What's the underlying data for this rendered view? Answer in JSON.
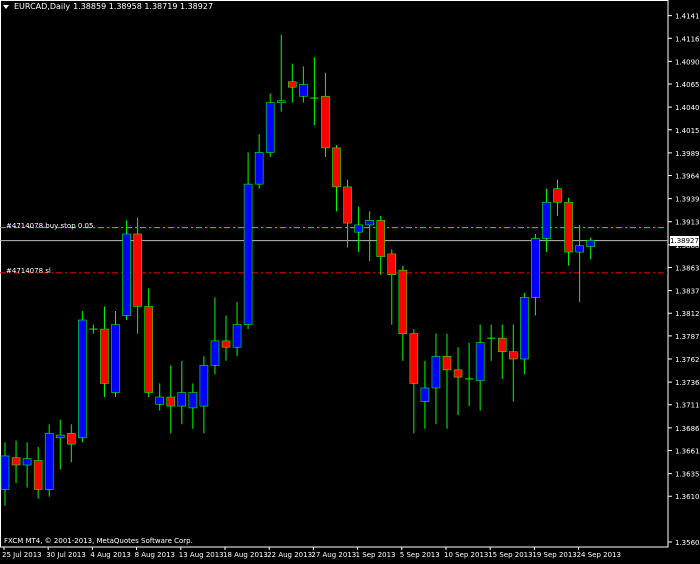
{
  "header": {
    "symbol_label": "EURCAD,Daily",
    "ohlc": "1.38859 1.38958 1.38719 1.38927"
  },
  "footer": {
    "copyright": "FXCM MT4, © 2001-2013, MetaQuotes Software Corp."
  },
  "levels": {
    "buy_stop": {
      "label": "#4714078 buy stop 0.05",
      "price": 1.3907,
      "color": "#00ff00"
    },
    "stop_loss": {
      "label": "#4714078 sl",
      "price": 1.3857,
      "color": "#ff0000"
    },
    "current": {
      "label": "1.38927",
      "price": 1.38927
    }
  },
  "colors": {
    "background": "#000000",
    "bull": "#0000ff",
    "bear": "#ff0000",
    "wick": "#00ff00",
    "axis": "#ffffff"
  },
  "chart_data": {
    "type": "candlestick",
    "ylim": [
      1.356,
      1.4145
    ],
    "y_ticks": [
      "1.41410",
      "1.41160",
      "1.40905",
      "1.40655",
      "1.40400",
      "1.40150",
      "1.39895",
      "1.39645",
      "1.39390",
      "1.39135",
      "1.38880",
      "1.38630",
      "1.38375",
      "1.38125",
      "1.37875",
      "1.37620",
      "1.37365",
      "1.37115",
      "1.36860",
      "1.36610",
      "1.36355",
      "1.36105",
      "1.35600"
    ],
    "x_ticks": [
      "25 Jul 2013",
      "30 Jul 2013",
      "4 Aug 2013",
      "8 Aug 2013",
      "13 Aug 2013",
      "18 Aug 2013",
      "22 Aug 2013",
      "27 Aug 2013",
      "1 Sep 2013",
      "5 Sep 2013",
      "10 Sep 2013",
      "15 Sep 2013",
      "19 Sep 2013",
      "24 Sep 2013"
    ],
    "candles": [
      {
        "o": 1.3618,
        "h": 1.367,
        "l": 1.36,
        "c": 1.3655
      },
      {
        "o": 1.3653,
        "h": 1.3672,
        "l": 1.3625,
        "c": 1.3645
      },
      {
        "o": 1.3645,
        "h": 1.367,
        "l": 1.362,
        "c": 1.3652
      },
      {
        "o": 1.365,
        "h": 1.3665,
        "l": 1.3608,
        "c": 1.3618
      },
      {
        "o": 1.3618,
        "h": 1.369,
        "l": 1.361,
        "c": 1.368
      },
      {
        "o": 1.3675,
        "h": 1.3695,
        "l": 1.364,
        "c": 1.3678
      },
      {
        "o": 1.368,
        "h": 1.369,
        "l": 1.3648,
        "c": 1.3668
      },
      {
        "o": 1.3675,
        "h": 1.3815,
        "l": 1.367,
        "c": 1.3805
      },
      {
        "o": 1.3795,
        "h": 1.38,
        "l": 1.379,
        "c": 1.3795
      },
      {
        "o": 1.3795,
        "h": 1.382,
        "l": 1.372,
        "c": 1.3735
      },
      {
        "o": 1.3725,
        "h": 1.3815,
        "l": 1.372,
        "c": 1.38
      },
      {
        "o": 1.381,
        "h": 1.3915,
        "l": 1.3805,
        "c": 1.39
      },
      {
        "o": 1.39,
        "h": 1.3918,
        "l": 1.379,
        "c": 1.382
      },
      {
        "o": 1.382,
        "h": 1.384,
        "l": 1.372,
        "c": 1.3725
      },
      {
        "o": 1.3712,
        "h": 1.3735,
        "l": 1.3705,
        "c": 1.372
      },
      {
        "o": 1.372,
        "h": 1.3755,
        "l": 1.368,
        "c": 1.371
      },
      {
        "o": 1.371,
        "h": 1.376,
        "l": 1.369,
        "c": 1.3725
      },
      {
        "o": 1.3708,
        "h": 1.3735,
        "l": 1.3685,
        "c": 1.3725
      },
      {
        "o": 1.371,
        "h": 1.3765,
        "l": 1.368,
        "c": 1.3755
      },
      {
        "o": 1.3755,
        "h": 1.383,
        "l": 1.3745,
        "c": 1.3782
      },
      {
        "o": 1.3782,
        "h": 1.381,
        "l": 1.376,
        "c": 1.3775
      },
      {
        "o": 1.3775,
        "h": 1.3825,
        "l": 1.3765,
        "c": 1.38
      },
      {
        "o": 1.38,
        "h": 1.399,
        "l": 1.3795,
        "c": 1.3955
      },
      {
        "o": 1.3955,
        "h": 1.401,
        "l": 1.395,
        "c": 1.399
      },
      {
        "o": 1.399,
        "h": 1.4055,
        "l": 1.3985,
        "c": 1.4045
      },
      {
        "o": 1.4045,
        "h": 1.412,
        "l": 1.4035,
        "c": 1.4047
      },
      {
        "o": 1.4068,
        "h": 1.4088,
        "l": 1.4045,
        "c": 1.4062
      },
      {
        "o": 1.4052,
        "h": 1.4085,
        "l": 1.4045,
        "c": 1.4065
      },
      {
        "o": 1.405,
        "h": 1.4095,
        "l": 1.402,
        "c": 1.405
      },
      {
        "o": 1.4052,
        "h": 1.4078,
        "l": 1.3985,
        "c": 1.3995
      },
      {
        "o": 1.3995,
        "h": 1.3998,
        "l": 1.3925,
        "c": 1.3952
      },
      {
        "o": 1.3952,
        "h": 1.396,
        "l": 1.3885,
        "c": 1.3912
      },
      {
        "o": 1.3902,
        "h": 1.393,
        "l": 1.388,
        "c": 1.391
      },
      {
        "o": 1.391,
        "h": 1.3925,
        "l": 1.387,
        "c": 1.3915
      },
      {
        "o": 1.3915,
        "h": 1.392,
        "l": 1.3855,
        "c": 1.3875
      },
      {
        "o": 1.3878,
        "h": 1.3883,
        "l": 1.38,
        "c": 1.3855
      },
      {
        "o": 1.386,
        "h": 1.3865,
        "l": 1.376,
        "c": 1.379
      },
      {
        "o": 1.379,
        "h": 1.3795,
        "l": 1.368,
        "c": 1.3735
      },
      {
        "o": 1.3715,
        "h": 1.376,
        "l": 1.3685,
        "c": 1.373
      },
      {
        "o": 1.373,
        "h": 1.379,
        "l": 1.369,
        "c": 1.3765
      },
      {
        "o": 1.3765,
        "h": 1.379,
        "l": 1.3685,
        "c": 1.375
      },
      {
        "o": 1.375,
        "h": 1.3775,
        "l": 1.37,
        "c": 1.3742
      },
      {
        "o": 1.374,
        "h": 1.378,
        "l": 1.371,
        "c": 1.374
      },
      {
        "o": 1.3738,
        "h": 1.38,
        "l": 1.3705,
        "c": 1.378
      },
      {
        "o": 1.3785,
        "h": 1.38,
        "l": 1.376,
        "c": 1.3785
      },
      {
        "o": 1.3785,
        "h": 1.38,
        "l": 1.374,
        "c": 1.377
      },
      {
        "o": 1.377,
        "h": 1.38,
        "l": 1.3715,
        "c": 1.3762
      },
      {
        "o": 1.3762,
        "h": 1.3835,
        "l": 1.3745,
        "c": 1.383
      },
      {
        "o": 1.383,
        "h": 1.39,
        "l": 1.381,
        "c": 1.3895
      },
      {
        "o": 1.3895,
        "h": 1.395,
        "l": 1.388,
        "c": 1.3935
      },
      {
        "o": 1.395,
        "h": 1.396,
        "l": 1.392,
        "c": 1.3935
      },
      {
        "o": 1.3935,
        "h": 1.394,
        "l": 1.3865,
        "c": 1.388
      },
      {
        "o": 1.388,
        "h": 1.391,
        "l": 1.3825,
        "c": 1.3887
      },
      {
        "o": 1.3886,
        "h": 1.3896,
        "l": 1.3872,
        "c": 1.3893
      }
    ]
  }
}
